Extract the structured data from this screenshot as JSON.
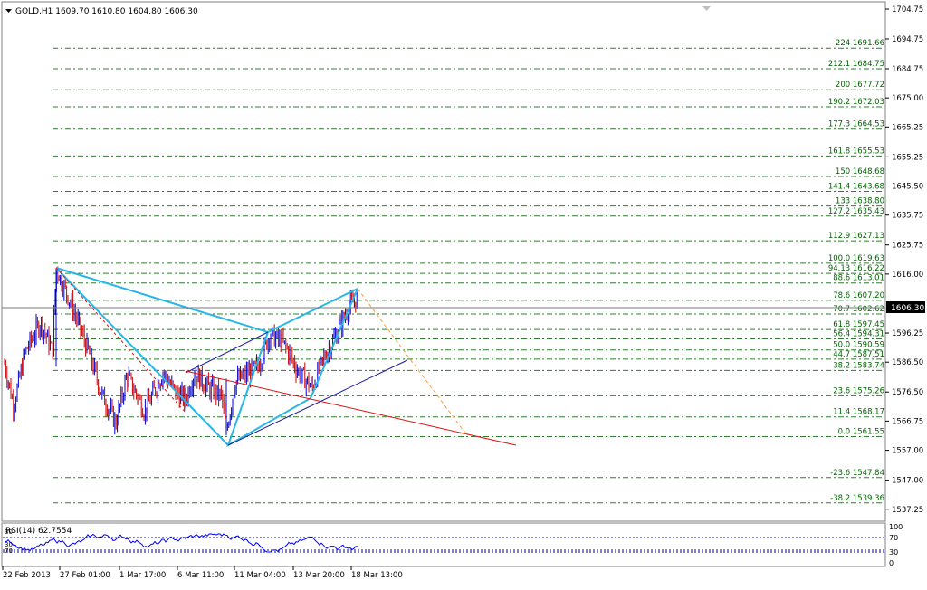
{
  "window": {
    "title": "GOLD,H1  1609.70 1610.80 1604.80 1606.30",
    "symbol": "GOLD,H1",
    "ohlc": "1609.70 1610.80 1604.80 1606.30",
    "menu_icon": "triangle-down-icon",
    "corner_icon": "triangle-down-icon"
  },
  "colors": {
    "background": "#ffffff",
    "fib_line": "#2f7f2f",
    "fib_text": "#006400",
    "axis_text": "#000000",
    "bull_candle": "#0000cc",
    "bear_candle": "#cc0000",
    "pattern": "#29b6e8",
    "channel": "#1a1aa0",
    "trend_red": "#e01010",
    "projection": "#ff9c3a",
    "bid_line": "#7a7a7a",
    "price_label_bg": "#000000",
    "rsi_line": "#0000ff",
    "rsi_level": "#0000aa"
  },
  "price_axis": {
    "ticks": [
      "1704.75",
      "1694.75",
      "1684.75",
      "1675.00",
      "1665.25",
      "1655.25",
      "1645.50",
      "1635.75",
      "1625.75",
      "1616.00",
      "1606.30",
      "1596.25",
      "1586.50",
      "1576.50",
      "1566.75",
      "1557.00",
      "1547.00",
      "1537.25"
    ],
    "current_price": "1606.30"
  },
  "fib_levels": [
    {
      "label": "224 1691.66"
    },
    {
      "label": "212.1 1684.75"
    },
    {
      "label": "200 1677.72"
    },
    {
      "label": "190.2 1672.03"
    },
    {
      "label": "177.3 1664.53"
    },
    {
      "label": "161.8 1655.53"
    },
    {
      "label": "150 1648.68"
    },
    {
      "label": "141.4 1643.68"
    },
    {
      "label": "133 1638.80"
    },
    {
      "label": "127.2 1635.43"
    },
    {
      "label": "112.9 1627.13"
    },
    {
      "label": "100.0 1619.63"
    },
    {
      "label": "94.13 1616.22"
    },
    {
      "label": "88.6 1613.01"
    },
    {
      "label": "78.6 1607.20"
    },
    {
      "label": "70.7 1602.62"
    },
    {
      "label": "61.8 1597.45"
    },
    {
      "label": "56.4 1594.31"
    },
    {
      "label": "50.0 1590.59"
    },
    {
      "label": "44.7 1587.51"
    },
    {
      "label": "38.2 1583.74"
    },
    {
      "label": "23.6 1575.26"
    },
    {
      "label": "11.4 1568.17"
    },
    {
      "label": "0.0 1561.55"
    },
    {
      "label": "-23.6 1547.84"
    },
    {
      "label": "-38.2 1539.36"
    }
  ],
  "rsi": {
    "title": "RSI(14) 62.7554",
    "axis_labels": [
      "100",
      "70",
      "30",
      "0"
    ],
    "left_marks": [
      "30",
      "30",
      "70"
    ]
  },
  "time_axis": {
    "labels": [
      "22 Feb 2013",
      "27 Feb 01:00",
      "1 Mar 17:00",
      "6 Mar 11:00",
      "11 Mar 04:00",
      "13 Mar 20:00",
      "18 Mar 13:00"
    ]
  }
}
